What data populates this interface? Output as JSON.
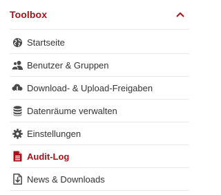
{
  "toolbox": {
    "title": "Toolbox",
    "collapse_icon": "chevron-up-icon",
    "accent_color": "#a8101b",
    "items": [
      {
        "label": "Startseite",
        "icon": "globe-icon",
        "active": false
      },
      {
        "label": "Benutzer & Gruppen",
        "icon": "users-icon",
        "active": false
      },
      {
        "label": "Download- & Upload-Freigaben",
        "icon": "cloud-download-icon",
        "active": false
      },
      {
        "label": "Datenräume verwalten",
        "icon": "database-icon",
        "active": false
      },
      {
        "label": "Einstellungen",
        "icon": "gear-icon",
        "active": false
      },
      {
        "label": "Audit-Log",
        "icon": "file-text-icon",
        "active": true
      },
      {
        "label": "News & Downloads",
        "icon": "download-file-icon",
        "active": false
      }
    ]
  }
}
